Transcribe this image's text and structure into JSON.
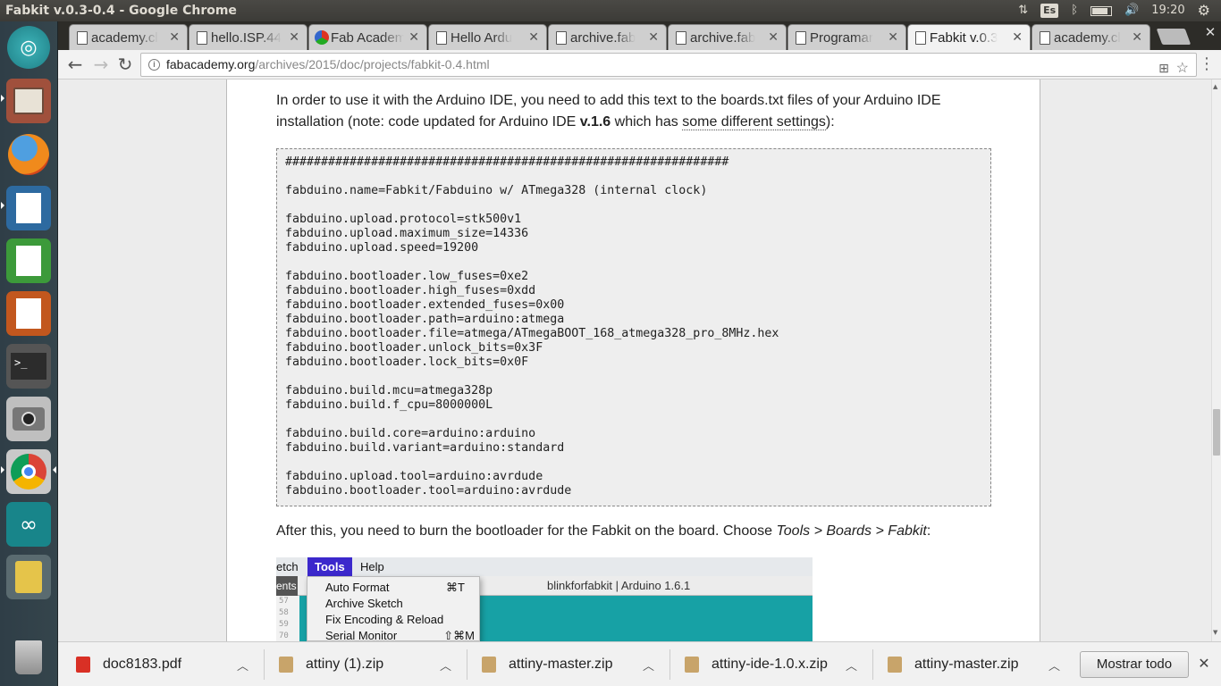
{
  "window": {
    "title": "Fabkit v.0.3-0.4 - Google Chrome"
  },
  "tray": {
    "keyboard": "Es",
    "clock": "19:20"
  },
  "tabs": [
    {
      "label": "academy.cl"
    },
    {
      "label": "hello.ISP.44"
    },
    {
      "label": "Fab Academ"
    },
    {
      "label": "Hello Ardu"
    },
    {
      "label": "archive.fab"
    },
    {
      "label": "archive.fab"
    },
    {
      "label": "Programar"
    },
    {
      "label": "Fabkit v.0.3"
    },
    {
      "label": "academy.cl"
    }
  ],
  "omnibox": {
    "host": "fabacademy.org",
    "path": "/archives/2015/doc/projects/fabkit-0.4.html"
  },
  "article": {
    "intro_line1": "In order to use it with the Arduino IDE, you need to add this text to the boards.txt files of your Arduino IDE",
    "intro_line2_a": "installation (note: code updated for Arduino IDE ",
    "intro_line2_bold": "v.1.6",
    "intro_line2_b": " which has ",
    "intro_line2_link": "some different settings",
    "intro_line2_c": "):",
    "code": "##############################################################\n\nfabduino.name=Fabkit/Fabduino w/ ATmega328 (internal clock)\n\nfabduino.upload.protocol=stk500v1\nfabduino.upload.maximum_size=14336\nfabduino.upload.speed=19200\n\nfabduino.bootloader.low_fuses=0xe2\nfabduino.bootloader.high_fuses=0xdd\nfabduino.bootloader.extended_fuses=0x00\nfabduino.bootloader.path=arduino:atmega\nfabduino.bootloader.file=atmega/ATmegaBOOT_168_atmega328_pro_8MHz.hex\nfabduino.bootloader.unlock_bits=0x3F\nfabduino.bootloader.lock_bits=0x0F\n\nfabduino.build.mcu=atmega328p\nfabduino.build.f_cpu=8000000L\n\nfabduino.build.core=arduino:arduino\nfabduino.build.variant=arduino:standard\n\nfabduino.upload.tool=arduino:avrdude\nfabduino.bootloader.tool=arduino:avrdude",
    "after_a": "After this, you need to burn the bootloader for the Fabkit on the board. Choose ",
    "after_italic": "Tools > Boards > Fabkit",
    "after_b": ":"
  },
  "ide_screenshot": {
    "menu_sketch": "etch",
    "menu_tools": "Tools",
    "menu_help": "Help",
    "window_title": "blinkforfabkit | Arduino 1.6.1",
    "left_fragment": "ents",
    "gutter": [
      "57",
      "58",
      "59",
      "70"
    ],
    "items": [
      {
        "label": "Auto Format",
        "shortcut": "⌘T"
      },
      {
        "label": "Archive Sketch",
        "shortcut": ""
      },
      {
        "label": "Fix Encoding & Reload",
        "shortcut": ""
      },
      {
        "label": "Serial Monitor",
        "shortcut": "⇧⌘M"
      }
    ]
  },
  "downloads": [
    {
      "name": "doc8183.pdf",
      "type": "pdf"
    },
    {
      "name": "attiny (1).zip",
      "type": "zip"
    },
    {
      "name": "attiny-master.zip",
      "type": "zip"
    },
    {
      "name": "attiny-ide-1.0.x.zip",
      "type": "zip"
    },
    {
      "name": "attiny-master.zip",
      "type": "zip"
    }
  ],
  "shelf": {
    "show_all": "Mostrar todo"
  },
  "colors": {
    "tools_menu_highlight": "#3b28cc",
    "arduino_teal": "#17a1a5",
    "launcher_bg": "#2f3e47"
  }
}
